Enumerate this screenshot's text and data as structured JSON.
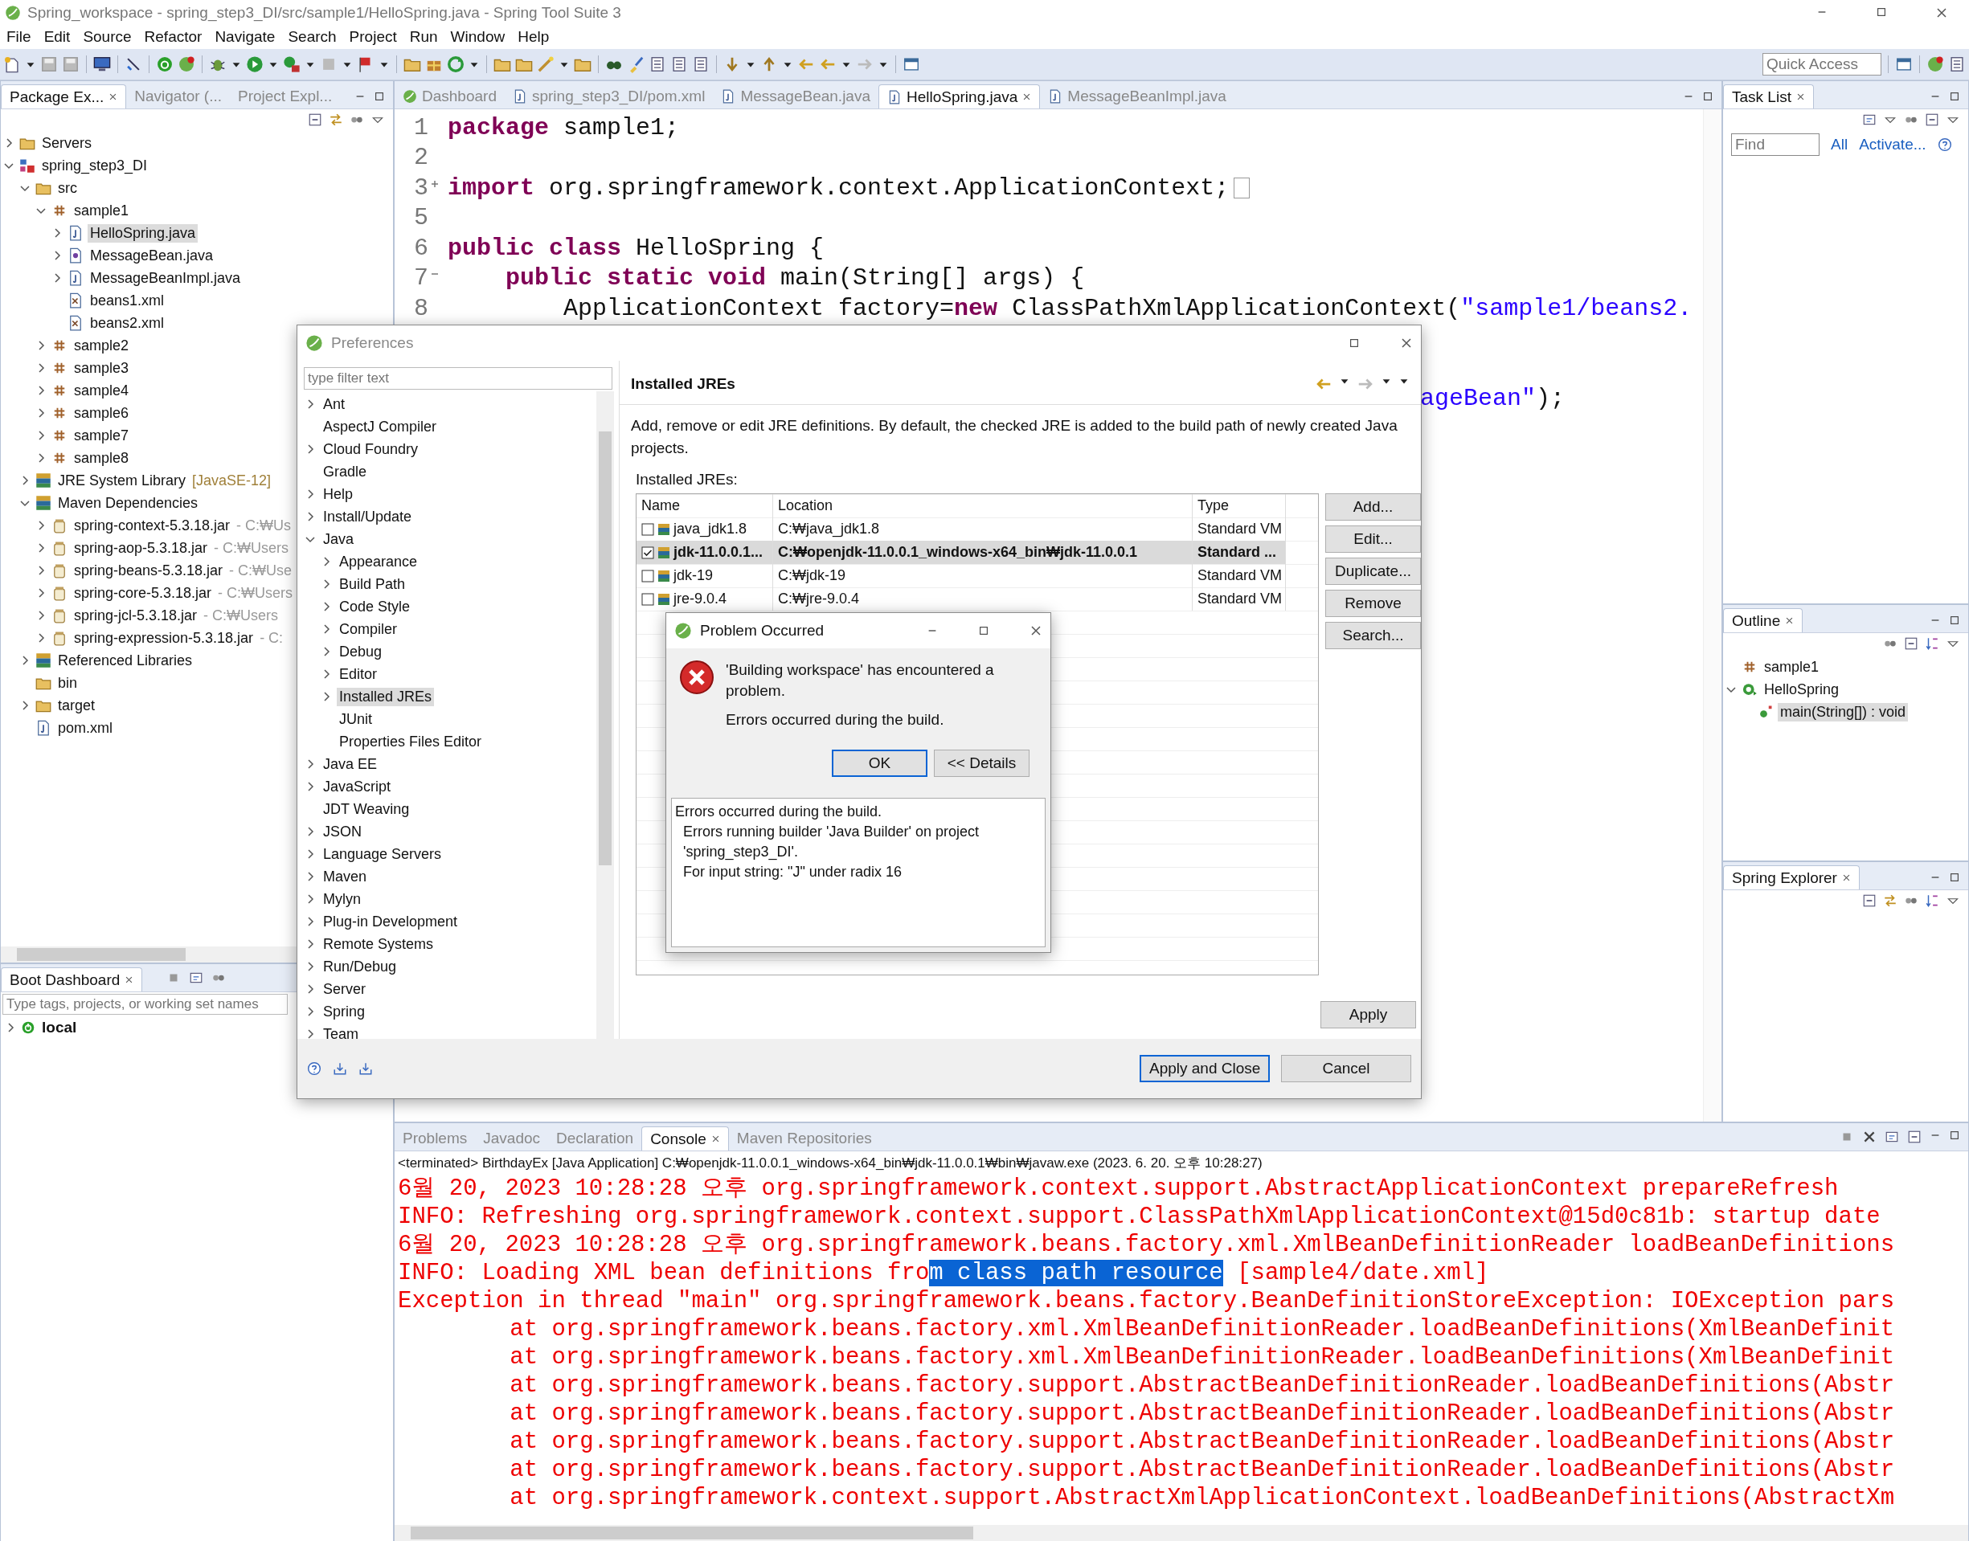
{
  "window": {
    "title": "Spring_workspace - spring_step3_DI/src/sample1/HelloSpring.java - Spring Tool Suite 3"
  },
  "menu": [
    "File",
    "Edit",
    "Source",
    "Refactor",
    "Navigate",
    "Search",
    "Project",
    "Run",
    "Window",
    "Help"
  ],
  "quick_access": {
    "placeholder": "Quick Access"
  },
  "package_explorer": {
    "tabs": [
      {
        "label": "Package Ex...",
        "selected": true
      },
      {
        "label": "Navigator (...",
        "selected": false
      },
      {
        "label": "Project Expl...",
        "selected": false
      }
    ],
    "tree": [
      {
        "label": "Servers",
        "kind": "folder",
        "expanded": false,
        "selected": false
      },
      {
        "label": "spring_step3_DI",
        "kind": "project",
        "expanded": true,
        "selected": false,
        "children": [
          {
            "label": "src",
            "kind": "folder",
            "expanded": true,
            "selected": false,
            "children": [
              {
                "label": "sample1",
                "kind": "package",
                "expanded": true,
                "selected": false,
                "children": [
                  {
                    "label": "HelloSpring.java",
                    "kind": "java",
                    "expanded": false,
                    "selected": true
                  },
                  {
                    "label": "MessageBean.java",
                    "kind": "interface",
                    "expanded": false,
                    "selected": false
                  },
                  {
                    "label": "MessageBeanImpl.java",
                    "kind": "java",
                    "expanded": false,
                    "selected": false
                  },
                  {
                    "label": "beans1.xml",
                    "kind": "xml",
                    "selected": false
                  },
                  {
                    "label": "beans2.xml",
                    "kind": "xml",
                    "selected": false
                  }
                ]
              },
              {
                "label": "sample2",
                "kind": "package",
                "expanded": false,
                "selected": false
              },
              {
                "label": "sample3",
                "kind": "package",
                "expanded": false,
                "selected": false
              },
              {
                "label": "sample4",
                "kind": "package",
                "expanded": false,
                "selected": false
              },
              {
                "label": "sample6",
                "kind": "package",
                "expanded": false,
                "selected": false
              },
              {
                "label": "sample7",
                "kind": "package",
                "expanded": false,
                "selected": false
              },
              {
                "label": "sample8",
                "kind": "package",
                "expanded": false,
                "selected": false
              }
            ]
          },
          {
            "label": "JRE System Library",
            "decoration": "[JavaSE-12]",
            "kind": "library",
            "expanded": false,
            "selected": false
          },
          {
            "label": "Maven Dependencies",
            "kind": "library",
            "expanded": true,
            "selected": false,
            "children": [
              {
                "label": "spring-context-5.3.18.jar",
                "decoration": "- C:₩Us",
                "kind": "jar",
                "expanded": false,
                "selected": false
              },
              {
                "label": "spring-aop-5.3.18.jar",
                "decoration": "- C:₩Users",
                "kind": "jar",
                "expanded": false,
                "selected": false
              },
              {
                "label": "spring-beans-5.3.18.jar",
                "decoration": "- C:₩Use",
                "kind": "jar",
                "expanded": false,
                "selected": false
              },
              {
                "label": "spring-core-5.3.18.jar",
                "decoration": "- C:₩Users",
                "kind": "jar",
                "expanded": false,
                "selected": false
              },
              {
                "label": "spring-jcl-5.3.18.jar",
                "decoration": "- C:₩Users",
                "kind": "jar",
                "expanded": false,
                "selected": false
              },
              {
                "label": "spring-expression-5.3.18.jar",
                "decoration": "- C:",
                "kind": "jar",
                "expanded": false,
                "selected": false
              }
            ]
          },
          {
            "label": "Referenced Libraries",
            "kind": "library",
            "expanded": false,
            "selected": false
          },
          {
            "label": "bin",
            "kind": "folder",
            "selected": false
          },
          {
            "label": "target",
            "kind": "folder",
            "expanded": false,
            "selected": false
          },
          {
            "label": "pom.xml",
            "kind": "pom",
            "selected": false
          }
        ]
      }
    ]
  },
  "boot_dashboard": {
    "title": "Boot Dashboard",
    "filter_placeholder": "Type tags, projects, or working set names",
    "items": [
      {
        "label": "local",
        "expanded": false
      }
    ]
  },
  "editor": {
    "tabs": [
      {
        "label": "Dashboard",
        "kind": "leaf",
        "selected": false
      },
      {
        "label": "spring_step3_DI/pom.xml",
        "kind": "pom",
        "selected": false
      },
      {
        "label": "MessageBean.java",
        "kind": "java",
        "selected": false
      },
      {
        "label": "HelloSpring.java",
        "kind": "java",
        "selected": true
      },
      {
        "label": "MessageBeanImpl.java",
        "kind": "java",
        "selected": false
      }
    ],
    "lines": [
      {
        "number": "1",
        "segments": [
          {
            "text": "package",
            "kind": "keyword"
          },
          {
            "text": " sample1;",
            "kind": "plain"
          }
        ]
      },
      {
        "number": "2"
      },
      {
        "number": "3",
        "folded": true,
        "segments": [
          {
            "text": "import",
            "kind": "keyword"
          },
          {
            "text": " org.springframework.context.ApplicationContext;",
            "kind": "plain"
          }
        ]
      },
      {
        "number": "5"
      },
      {
        "number": "6",
        "segments": [
          {
            "text": "public class",
            "kind": "keyword"
          },
          {
            "text": " HelloSpring {",
            "kind": "plain"
          }
        ]
      },
      {
        "number": "7",
        "fold": true,
        "segments": [
          {
            "text": "    public static void",
            "kind": "keyword"
          },
          {
            "text": " main(String[] args) {",
            "kind": "plain"
          }
        ]
      },
      {
        "number": "8",
        "segments": [
          {
            "text": "        ApplicationContext factory=",
            "kind": "plain"
          },
          {
            "text": "new",
            "kind": "keyword"
          },
          {
            "text": " ClassPathXmlApplicationContext(",
            "kind": "plain"
          },
          {
            "text": "\"sample1/beans2.",
            "kind": "string"
          }
        ]
      }
    ],
    "partial_line": {
      "segments": [
        {
          "text": "ageBean\"",
          "kind": "string"
        },
        {
          "text": ");",
          "kind": "plain"
        }
      ]
    }
  },
  "task_list": {
    "title": "Task List",
    "find_placeholder": "Find",
    "links": [
      "All",
      "Activate..."
    ]
  },
  "outline": {
    "title": "Outline",
    "items": [
      {
        "label": "sample1",
        "kind": "package",
        "selected": false
      },
      {
        "label": "HelloSpring",
        "kind": "class",
        "expanded": true,
        "selected": false,
        "children": [
          {
            "label": "main(String[]) : void",
            "kind": "method",
            "selected": true
          }
        ]
      }
    ]
  },
  "spring_explorer": {
    "title": "Spring Explorer"
  },
  "console": {
    "tabs": [
      {
        "label": "Problems",
        "selected": false
      },
      {
        "label": "Javadoc",
        "selected": false
      },
      {
        "label": "Declaration",
        "selected": false
      },
      {
        "label": "Console",
        "selected": true
      },
      {
        "label": "Maven Repositories",
        "selected": false
      }
    ],
    "header": "<terminated> BirthdayEx [Java Application] C:₩openjdk-11.0.0.1_windows-x64_bin₩jdk-11.0.0.1₩bin₩javaw.exe (2023. 6. 20. 오후 10:28:27)",
    "lines": [
      {
        "text": "6월 20, 2023 10:28:28 오후 org.springframework.context.support.AbstractApplicationContext prepareRefresh"
      },
      {
        "text": "INFO: Refreshing org.springframework.context.support.ClassPathXmlApplicationContext@15d0c81b: startup date"
      },
      {
        "text": "6월 20, 2023 10:28:28 오후 org.springframework.beans.factory.xml.XmlBeanDefinitionReader loadBeanDefinitions"
      },
      {
        "parts": [
          {
            "text": "INFO: Loading XML bean definitions fro",
            "selected": false
          },
          {
            "text": "m class path resource",
            "selected": true
          },
          {
            "text": " [sample4/date.xml]",
            "selected": false
          }
        ]
      },
      {
        "text": "Exception in thread \"main\" org.springframework.beans.factory.BeanDefinitionStoreException: IOException pars"
      },
      {
        "text": "\tat org.springframework.beans.factory.xml.XmlBeanDefinitionReader.loadBeanDefinitions(XmlBeanDefinit"
      },
      {
        "text": "\tat org.springframework.beans.factory.xml.XmlBeanDefinitionReader.loadBeanDefinitions(XmlBeanDefinit"
      },
      {
        "text": "\tat org.springframework.beans.factory.support.AbstractBeanDefinitionReader.loadBeanDefinitions(Abstr"
      },
      {
        "text": "\tat org.springframework.beans.factory.support.AbstractBeanDefinitionReader.loadBeanDefinitions(Abstr"
      },
      {
        "text": "\tat org.springframework.beans.factory.support.AbstractBeanDefinitionReader.loadBeanDefinitions(Abstr"
      },
      {
        "text": "\tat org.springframework.beans.factory.support.AbstractBeanDefinitionReader.loadBeanDefinitions(Abstr"
      },
      {
        "text": "\tat org.springframework.context.support.AbstractXmlApplicationContext.loadBeanDefinitions(AbstractXm"
      }
    ]
  },
  "preferences": {
    "title": "Preferences",
    "filter_placeholder": "type filter text",
    "tree": [
      {
        "label": "Ant",
        "expanded": false,
        "selected": false
      },
      {
        "label": "AspectJ Compiler",
        "selected": false
      },
      {
        "label": "Cloud Foundry",
        "expanded": false,
        "selected": false
      },
      {
        "label": "Gradle",
        "selected": false
      },
      {
        "label": "Help",
        "expanded": false,
        "selected": false
      },
      {
        "label": "Install/Update",
        "expanded": false,
        "selected": false
      },
      {
        "label": "Java",
        "expanded": true,
        "selected": false,
        "children": [
          {
            "label": "Appearance",
            "expanded": false,
            "selected": false
          },
          {
            "label": "Build Path",
            "expanded": false,
            "selected": false
          },
          {
            "label": "Code Style",
            "expanded": false,
            "selected": false
          },
          {
            "label": "Compiler",
            "expanded": false,
            "selected": false
          },
          {
            "label": "Debug",
            "expanded": false,
            "selected": false
          },
          {
            "label": "Editor",
            "expanded": false,
            "selected": false
          },
          {
            "label": "Installed JREs",
            "expanded": false,
            "selected": true
          },
          {
            "label": "JUnit",
            "selected": false
          },
          {
            "label": "Properties Files Editor",
            "selected": false
          }
        ]
      },
      {
        "label": "Java EE",
        "expanded": false,
        "selected": false
      },
      {
        "label": "JavaScript",
        "expanded": false,
        "selected": false
      },
      {
        "label": "JDT Weaving",
        "selected": false
      },
      {
        "label": "JSON",
        "expanded": false,
        "selected": false
      },
      {
        "label": "Language Servers",
        "expanded": false,
        "selected": false
      },
      {
        "label": "Maven",
        "expanded": false,
        "selected": false
      },
      {
        "label": "Mylyn",
        "expanded": false,
        "selected": false
      },
      {
        "label": "Plug-in Development",
        "expanded": false,
        "selected": false
      },
      {
        "label": "Remote Systems",
        "expanded": false,
        "selected": false
      },
      {
        "label": "Run/Debug",
        "expanded": false,
        "selected": false
      },
      {
        "label": "Server",
        "expanded": false,
        "selected": false
      },
      {
        "label": "Spring",
        "expanded": false,
        "selected": false
      },
      {
        "label": "Team",
        "expanded": false,
        "selected": false
      }
    ],
    "page_title": "Installed JREs",
    "description": "Add, remove or edit JRE definitions. By default, the checked JRE is added to the build path of newly created Java projects.",
    "table_label": "Installed JREs:",
    "columns": [
      "Name",
      "Location",
      "Type"
    ],
    "rows": [
      {
        "name": "java_jdk1.8",
        "location": "C:₩java_jdk1.8",
        "type": "Standard VM",
        "checked": false,
        "selected": false
      },
      {
        "name": "jdk-11.0.0.1...",
        "location": "C:₩openjdk-11.0.0.1_windows-x64_bin₩jdk-11.0.0.1",
        "type": "Standard ...",
        "checked": true,
        "selected": true
      },
      {
        "name": "jdk-19",
        "location": "C:₩jdk-19",
        "type": "Standard VM",
        "checked": false,
        "selected": false
      },
      {
        "name": "jre-9.0.4",
        "location": "C:₩jre-9.0.4",
        "type": "Standard VM",
        "checked": false,
        "selected": false
      }
    ],
    "side_buttons": [
      "Add...",
      "Edit...",
      "Duplicate...",
      "Remove",
      "Search..."
    ],
    "apply": "Apply",
    "footer_buttons": [
      {
        "label": "Apply and Close",
        "default": true
      },
      {
        "label": "Cancel",
        "default": false
      }
    ]
  },
  "problem": {
    "title": "Problem Occurred",
    "message": "'Building workspace' has encountered a problem.",
    "summary": "Errors occurred during the build.",
    "buttons": [
      {
        "label": "OK",
        "default": true
      },
      {
        "label": "<< Details",
        "default": false
      }
    ],
    "details": "Errors occurred during the build.\n  Errors running builder 'Java Builder' on project\n  'spring_step3_DI'.\n  For input string: \"J\" under radix 16"
  }
}
